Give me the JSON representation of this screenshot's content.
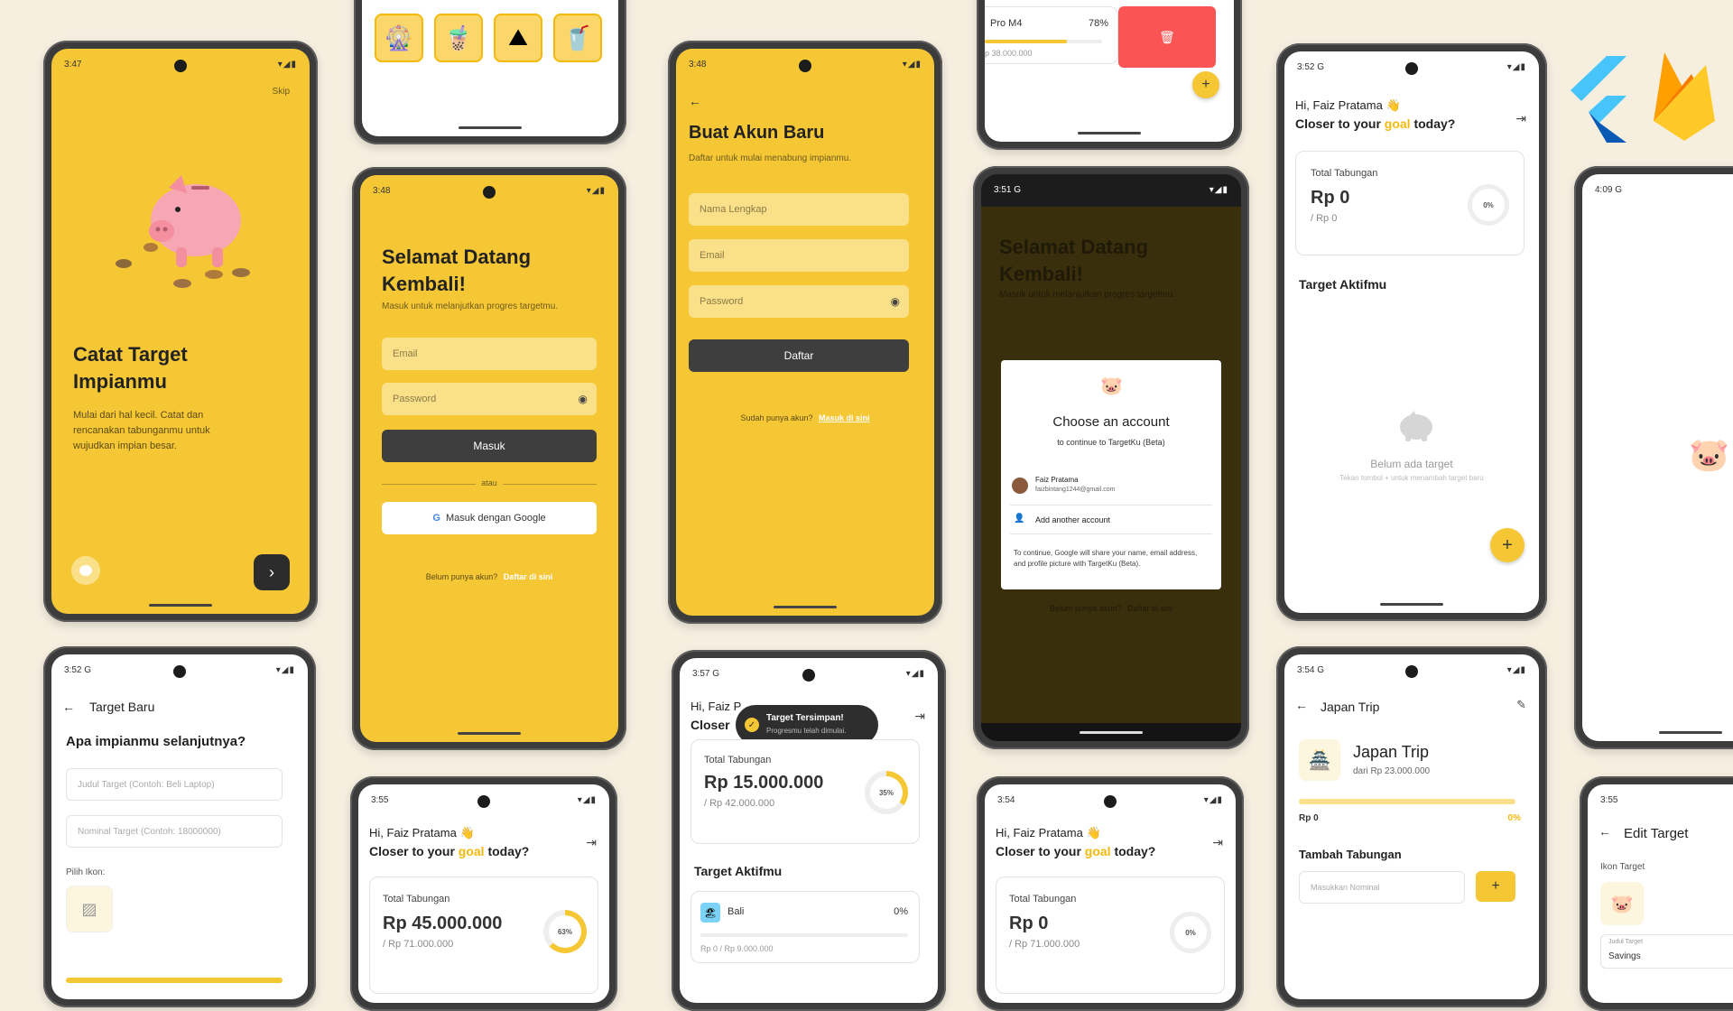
{
  "status": {
    "t347": "3:47",
    "t348": "3:48",
    "t351": "3:51",
    "t352": "3:52",
    "t355": "3:55",
    "t357": "3:57",
    "t354": "3:54",
    "t409": "4:09",
    "g": "G"
  },
  "onboarding": {
    "skip": "Skip",
    "title_line1": "Catat Target",
    "title_line2": "Impianmu",
    "desc": "Mulai dari hal kecil. Catat dan rencanakan tabunganmu untuk wujudkan impian besar."
  },
  "login": {
    "title_line1": "Selamat Datang",
    "title_line2": "Kembali!",
    "subtitle": "Masuk untuk melanjutkan progres targetmu.",
    "email_placeholder": "Email",
    "password_placeholder": "Password",
    "login_button": "Masuk",
    "divider": "atau",
    "google_button": "Masuk dengan Google",
    "google_g": "G",
    "no_account": "Belum punya akun?",
    "register_link": "Daftar di sini"
  },
  "register": {
    "title": "Buat Akun Baru",
    "subtitle": "Daftar untuk mulai menabung impianmu.",
    "name_placeholder": "Nama Lengkap",
    "email_placeholder": "Email",
    "password_placeholder": "Password",
    "register_button": "Daftar",
    "have_account": "Sudah punya akun?",
    "login_link": "Masuk di sini"
  },
  "account_chooser": {
    "title": "Choose an account",
    "subtitle": "to continue to TargetKu (Beta)",
    "name": "Faiz Pratama",
    "email": "faizbintang1244@gmail.com",
    "add_account": "Add another account",
    "notice": "To continue, Google will share your name, email address, and profile picture with TargetKu (Beta)."
  },
  "home": {
    "greeting": "Hi, Faiz Pratama",
    "greeting_short": "Hi, Faiz P",
    "question_pre": "Closer to your ",
    "question_goal": "goal",
    "question_post": " today?",
    "closer_short": "Closer",
    "savings_label": "Total Tabungan",
    "active_targets": "Target Aktifmu",
    "empty_title": "Belum ada target",
    "empty_hint": "Tekan tombol + untuk menambah target baru",
    "toast_title": "Target Tersimpan!",
    "toast_sub": "Progresmu telah dimulai.",
    "fab": "+"
  },
  "home_empty": {
    "amount": "Rp 0",
    "total": "/ Rp 0",
    "percent": "0%"
  },
  "home_57": {
    "amount": "Rp 15.000.000",
    "total": "/ Rp 42.000.000",
    "percent": "35%"
  },
  "home_55": {
    "amount": "Rp 45.000.000",
    "total": "/ Rp 71.000.000",
    "percent": "63%"
  },
  "home_54": {
    "amount": "Rp 0",
    "total": "/ Rp 71.000.000",
    "percent": "0%"
  },
  "target_bali": {
    "name": "Bali",
    "percent": "0%",
    "sub": "Rp 0 / Rp 9.000.000"
  },
  "top_card": {
    "name": "Pro M4",
    "percent": "78%",
    "sub": "p 38.000.000"
  },
  "new_target": {
    "header": "Target Baru",
    "question": "Apa impianmu selanjutnya?",
    "title_placeholder": "Judul Target (Contoh: Beli Laptop)",
    "amount_placeholder": "Nominal Target (Contoh: 18000000)",
    "icon_label": "Pilih Ikon:"
  },
  "detail": {
    "header": "Japan Trip",
    "title": "Japan Trip",
    "from": "dari Rp 23.000.000",
    "saved": "Rp 0",
    "percent": "0%",
    "add_label": "Tambah Tabungan",
    "amount_placeholder": "Masukkan Nominal",
    "add_button": "+"
  },
  "edit": {
    "header": "Edit Target",
    "icon_label": "Ikon Target",
    "field_label": "Judul Target",
    "field_value": "Savings"
  },
  "colors": {
    "accent": "#f6c735",
    "dark": "#3e3e3e",
    "danger": "#fb5454"
  }
}
